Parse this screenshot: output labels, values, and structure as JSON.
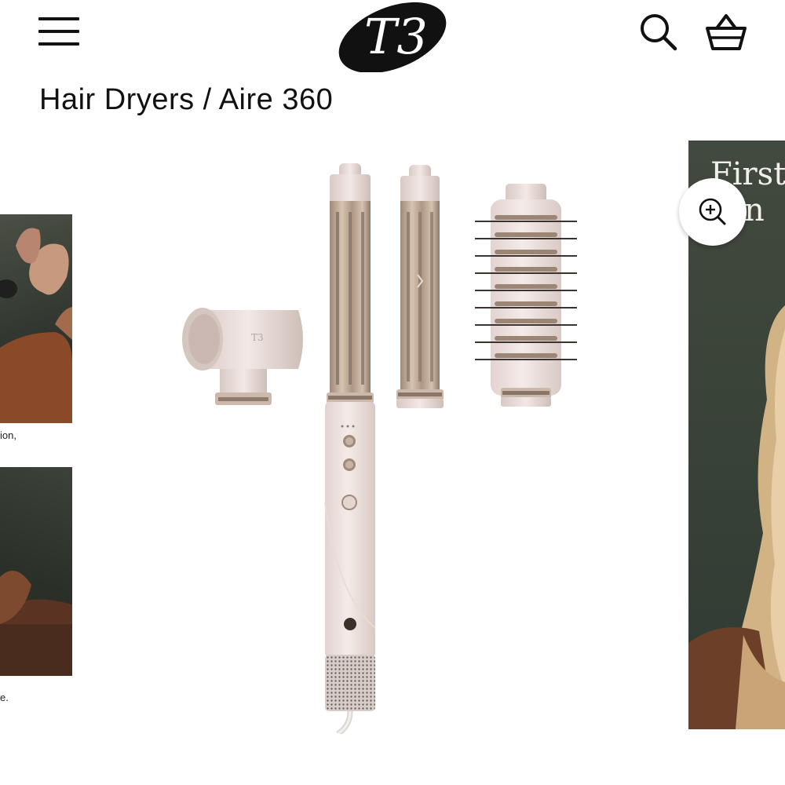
{
  "header": {
    "menu_icon": "hamburger-menu-icon",
    "logo_text": "T3",
    "search_icon": "search-icon",
    "cart_icon": "shopping-basket-icon"
  },
  "breadcrumb": {
    "text": "Hair Dryers / Aire 360"
  },
  "carousel": {
    "prev_slide": {
      "caption_top": "ion,",
      "caption_bottom": "e."
    },
    "next_slide": {
      "headline_line1": "First-",
      "headline_line2": "ran"
    },
    "zoom_icon": "zoom-in-icon"
  },
  "product": {
    "name": "Aire 360",
    "badge_text": "T3"
  },
  "colors": {
    "product_body": "#ece0dc",
    "barrel_metal": "#c7b19e",
    "dark_photo_bg": "#3b4339",
    "text": "#111111"
  }
}
